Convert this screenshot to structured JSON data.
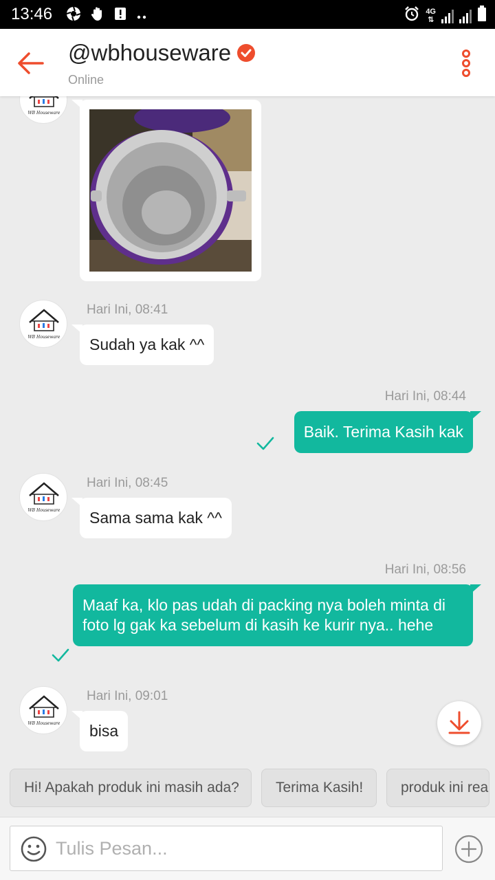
{
  "status_bar": {
    "time": "13:46",
    "network": "4G"
  },
  "header": {
    "title": "@wbhouseware",
    "status": "Online"
  },
  "colors": {
    "accent": "#ee4d2d",
    "outgoing_bubble": "#12b89e",
    "background": "#ececec"
  },
  "messages": [
    {
      "from": "shop",
      "type": "image"
    },
    {
      "from": "shop",
      "time": "Hari Ini, 08:41",
      "text": "Sudah ya kak ^^"
    },
    {
      "from": "me",
      "time": "Hari Ini, 08:44",
      "text": "Baik. Terima Kasih kak",
      "status": "sent"
    },
    {
      "from": "shop",
      "time": "Hari Ini, 08:45",
      "text": "Sama sama kak ^^"
    },
    {
      "from": "me",
      "time": "Hari Ini, 08:56",
      "text": "Maaf ka, klo pas udah di packing nya boleh minta di foto lg gak ka sebelum di kasih ke kurir nya.. hehe",
      "status": "sent"
    },
    {
      "from": "shop",
      "time": "Hari Ini, 09:01",
      "text": "bisa"
    }
  ],
  "quick_replies": [
    "Hi! Apakah produk ini masih ada?",
    "Terima Kasih!",
    "produk ini ready"
  ],
  "composer": {
    "placeholder": "Tulis Pesan..."
  },
  "icons": {
    "back": "arrow-left-icon",
    "verified": "verified-badge-icon",
    "more": "more-vertical-icon",
    "download": "download-icon",
    "emoji": "emoji-icon",
    "attach": "plus-circle-icon"
  },
  "avatar_logo_text": "WB Houseware"
}
